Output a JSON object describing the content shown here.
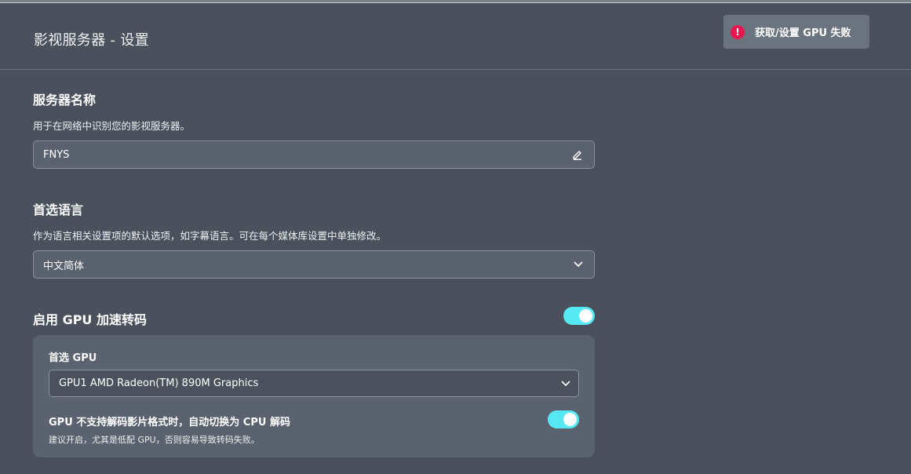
{
  "header": {
    "title": "影视服务器 - 设置"
  },
  "toast": {
    "icon": "alert-circle-icon",
    "icon_glyph": "!",
    "message": "获取/设置 GPU 失败",
    "icon_color": "#e8174f"
  },
  "server_name": {
    "title": "服务器名称",
    "description": "用于在网络中识别您的影视服务器。",
    "value": "FNYS",
    "edit_icon": "pencil-icon"
  },
  "preferred_language": {
    "title": "首选语言",
    "description": "作为语言相关设置项的默认选项，如字幕语言。可在每个媒体库设置中单独修改。",
    "selected": "中文简体",
    "dropdown_icon": "chevron-down-icon"
  },
  "gpu_transcode": {
    "title": "启用 GPU 加速转码",
    "enabled": true,
    "preferred_gpu_label": "首选 GPU",
    "preferred_gpu_selected": "GPU1 AMD Radeon(TM) 890M Graphics",
    "fallback_title": "GPU 不支持解码影片格式时，自动切换为 CPU 解码",
    "fallback_desc": "建议开启，尤其是低配 GPU，否则容易导致转码失败。",
    "fallback_enabled": true
  },
  "colors": {
    "background": "#4a515c",
    "accent_toggle": "#56e9f3",
    "panel": "#5a6270"
  }
}
